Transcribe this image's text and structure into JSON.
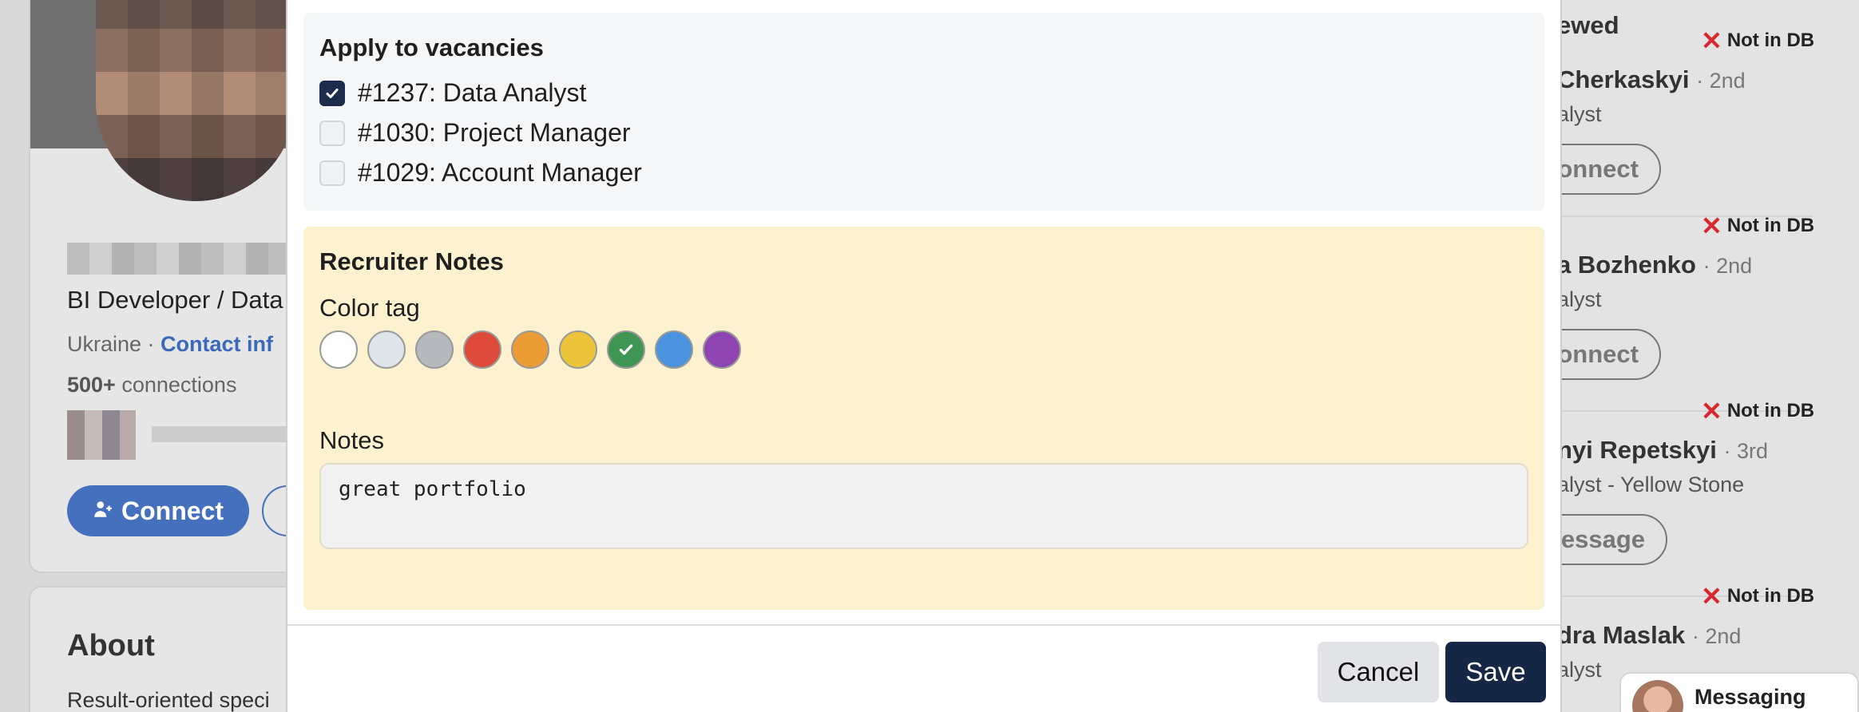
{
  "background_profile": {
    "headline": "BI Developer / Data",
    "location": "Ukraine ·",
    "contact_info": "Contact inf",
    "connections_count": "500+",
    "connections_label": "connections",
    "connect_button": "Connect",
    "about_title": "About",
    "about_text": "Result-oriented speci"
  },
  "right_panel": {
    "title": "ewed",
    "not_in_db_label": "Not in DB",
    "items": [
      {
        "name": "Cherkaskyi",
        "degree": "· 2nd",
        "role": "alyst",
        "button": "onnect"
      },
      {
        "name": "a Bozhenko",
        "degree": "· 2nd",
        "role": "alyst",
        "button": "onnect"
      },
      {
        "name": "nyi Repetskyi",
        "degree": "· 3rd",
        "role": "alyst - Yellow Stone",
        "button": "essage"
      },
      {
        "name": "dra Maslak",
        "degree": "· 2nd",
        "role": "alyst",
        "button": ""
      }
    ],
    "messaging_label": "Messaging"
  },
  "modal": {
    "vacancies": {
      "title": "Apply to vacancies",
      "items": [
        {
          "label": "#1237: Data Analyst",
          "checked": true
        },
        {
          "label": "#1030: Project Manager",
          "checked": false
        },
        {
          "label": "#1029: Account Manager",
          "checked": false
        }
      ]
    },
    "notes": {
      "title": "Recruiter Notes",
      "color_tag_label": "Color tag",
      "colors": [
        {
          "name": "white",
          "hex": "#ffffff"
        },
        {
          "name": "light-blue-gray",
          "hex": "#dde4ea"
        },
        {
          "name": "gray",
          "hex": "#b5b8bc"
        },
        {
          "name": "red",
          "hex": "#de4a3a"
        },
        {
          "name": "orange",
          "hex": "#eb9c34"
        },
        {
          "name": "yellow",
          "hex": "#ebc43a"
        },
        {
          "name": "green",
          "hex": "#3f9552",
          "selected": true
        },
        {
          "name": "blue",
          "hex": "#4b92df"
        },
        {
          "name": "purple",
          "hex": "#8e44b1"
        }
      ],
      "notes_label": "Notes",
      "notes_value": "great portfolio"
    },
    "buttons": {
      "cancel": "Cancel",
      "save": "Save"
    }
  }
}
